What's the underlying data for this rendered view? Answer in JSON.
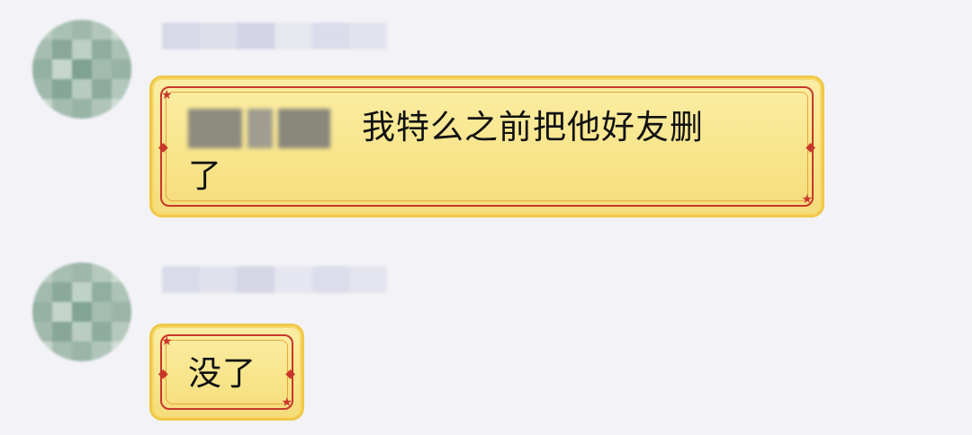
{
  "chat": {
    "messages": [
      {
        "text_line1": "我特么之前把他好友删",
        "text_line2": "了"
      },
      {
        "text_line1": "没了"
      }
    ]
  },
  "colors": {
    "background": "#f3f3f7",
    "bubble_fill": "#f8e58c",
    "bubble_border": "#f0c84a",
    "frame_red": "#c8372b",
    "text": "#111111"
  },
  "icons": {
    "corner_ornament": "star-icon",
    "side_ornament": "diamond-icon"
  }
}
